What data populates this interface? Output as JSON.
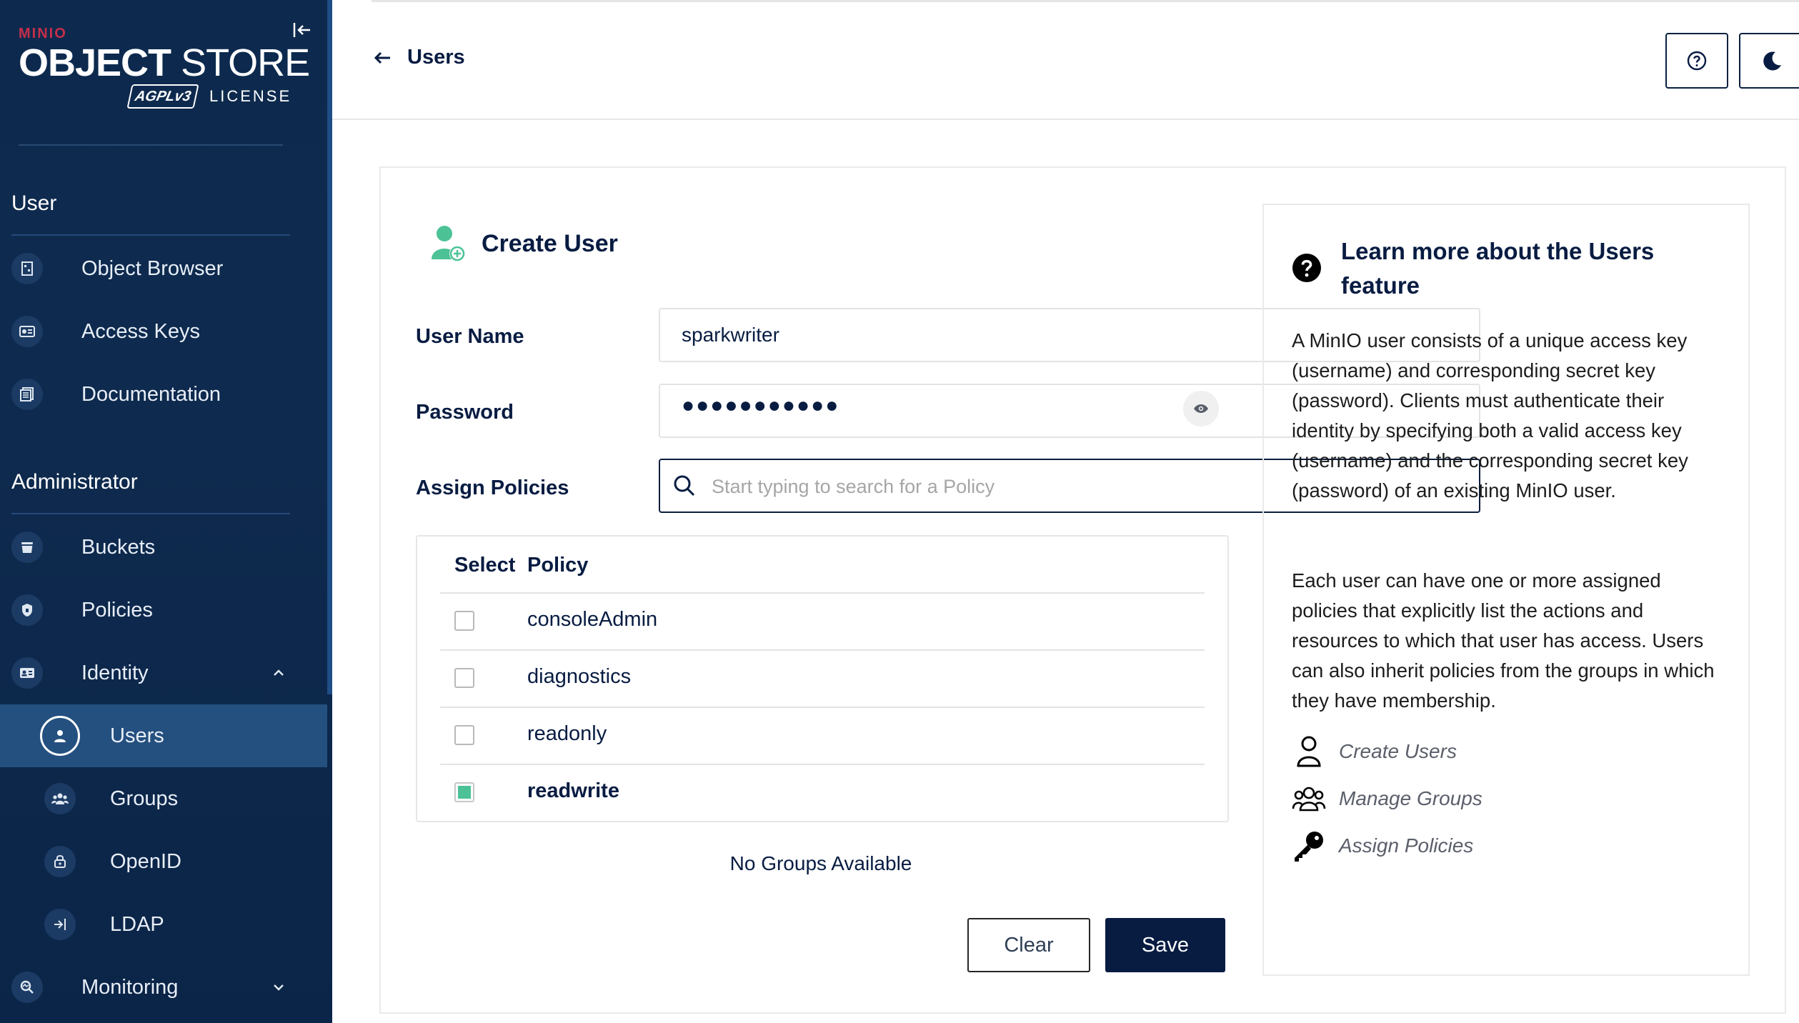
{
  "brand": {
    "company": "MINIO",
    "product_bold": "OBJECT",
    "product_thin": "STORE",
    "license_badge": "AGPLv3",
    "license_label": "LICENSE"
  },
  "sidebar": {
    "user_section": "User",
    "user_items": [
      {
        "label": "Object Browser",
        "icon": "object-browser-icon"
      },
      {
        "label": "Access Keys",
        "icon": "access-keys-icon"
      },
      {
        "label": "Documentation",
        "icon": "documentation-icon"
      }
    ],
    "admin_section": "Administrator",
    "admin_items": [
      {
        "label": "Buckets",
        "icon": "buckets-icon"
      },
      {
        "label": "Policies",
        "icon": "policies-icon"
      },
      {
        "label": "Identity",
        "icon": "identity-icon",
        "expanded": true
      }
    ],
    "identity_children": [
      {
        "label": "Users",
        "icon": "user-icon",
        "active": true
      },
      {
        "label": "Groups",
        "icon": "groups-icon"
      },
      {
        "label": "OpenID",
        "icon": "openid-icon"
      },
      {
        "label": "LDAP",
        "icon": "ldap-icon"
      }
    ],
    "monitoring": {
      "label": "Monitoring",
      "icon": "monitoring-icon"
    }
  },
  "header": {
    "back_label": "Users",
    "help_icon": "help-circle-icon",
    "theme_icon": "moon-icon"
  },
  "form": {
    "title": "Create User",
    "username_label": "User Name",
    "username_value": "sparkwriter",
    "password_label": "Password",
    "password_mask": "●●●●●●●●●●●",
    "policies_label": "Assign Policies",
    "policies_placeholder": "Start typing to search for a Policy",
    "table_headers": {
      "select": "Select",
      "policy": "Policy"
    },
    "policies": [
      {
        "name": "consoleAdmin",
        "selected": false
      },
      {
        "name": "diagnostics",
        "selected": false
      },
      {
        "name": "readonly",
        "selected": false
      },
      {
        "name": "readwrite",
        "selected": true
      }
    ],
    "no_groups": "No Groups Available",
    "clear_label": "Clear",
    "save_label": "Save"
  },
  "help": {
    "title": "Learn more about the Users feature",
    "p1": "A MinIO user consists of a unique access key (username) and corresponding secret key (password). Clients must authenticate their identity by specifying both a valid access key (username) and the corresponding secret key (password) of an existing MinIO user.",
    "p2": "Each user can have one or more assigned policies that explicitly list the actions and resources to which that user has access. Users can also inherit policies from the groups in which they have membership.",
    "links": [
      {
        "label": "Create Users",
        "icon": "user-outline-icon"
      },
      {
        "label": "Manage Groups",
        "icon": "groups-outline-icon"
      },
      {
        "label": "Assign Policies",
        "icon": "key-icon"
      }
    ]
  },
  "colors": {
    "sidebar_bg": "#0d2a4e",
    "active_item": "#24507f",
    "primary": "#081c42",
    "accent_green": "#4cc296",
    "brand_red": "#c72e49"
  }
}
